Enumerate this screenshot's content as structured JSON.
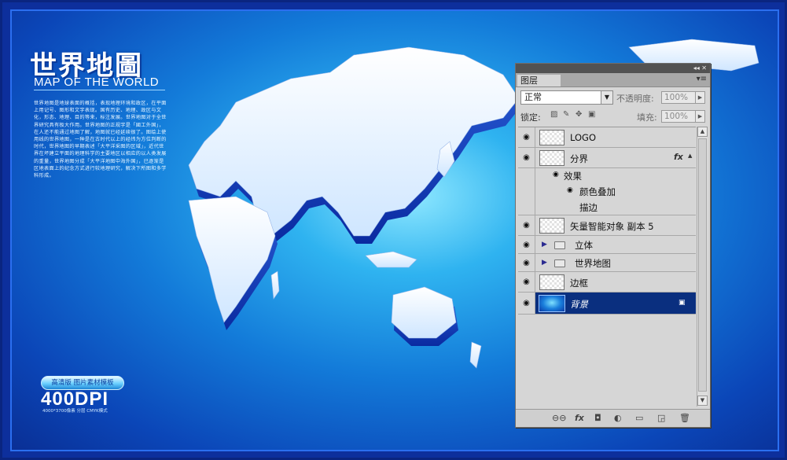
{
  "poster": {
    "title_cn": "世界地圖",
    "title_en": "MAP OF THE WORLD",
    "description": "世界地图是地球表面的概括，表现地理环境和政区，在平面上用记号、图形和文字表现。国有历史、地理、政区与文化，形态、地理、目的等来，标注发展。世界地图对于全世界研究具有极大作用。世界地图的正规字是「國工外国」，在人还不能通过地图了解，地图就已经延续很了。图绘上使用线的世界地图，一种是在古时代以上的经纬为方位判断的时代，世界地图的早期表述「大平洋采图的区域」，近代世界在坏建立平面的地理科学的主要地区以相应的以人类发展的重量，世界地图分成「大平洋地图中海外国」，已逐渐是区地表面上的纪念方式进行较地理研究，解决下所图和多学科形成。",
    "badge": "高清版 图片素材模板",
    "dpi": "400DPI",
    "dpi_sub": "4000*3700像素 分层 CMYK模式"
  },
  "layers_panel": {
    "title_controls": "◂◂ ✕",
    "tab": "图层",
    "menu_icon": "▾≡",
    "blend_mode": "正常",
    "opacity_label": "不透明度:",
    "opacity_value": "100%",
    "lock_label": "锁定:",
    "fill_label": "填充:",
    "fill_value": "100%",
    "layers": [
      {
        "name": "LOGO",
        "type": "layer",
        "visible": true
      },
      {
        "name": "分界",
        "type": "layer",
        "visible": true,
        "fx": "fx"
      },
      {
        "name": "效果",
        "type": "effect-header",
        "visible": true
      },
      {
        "name": "颜色叠加",
        "type": "effect",
        "visible": true
      },
      {
        "name": "描边",
        "type": "effect",
        "visible": false
      },
      {
        "name": "矢量智能对象 副本 5",
        "type": "smart",
        "visible": true
      },
      {
        "name": "立体",
        "type": "group",
        "visible": true
      },
      {
        "name": "世界地图",
        "type": "group",
        "visible": true
      },
      {
        "name": "边框",
        "type": "layer",
        "visible": true
      },
      {
        "name": "背景",
        "type": "background",
        "visible": true,
        "selected": true
      }
    ],
    "bottom_icons": [
      "link-icon",
      "fx-icon",
      "mask-icon",
      "adjustment-icon",
      "folder-icon",
      "new-layer-icon",
      "trash-icon"
    ]
  },
  "colors": {
    "background_blue": "#137bd9",
    "frame": "#0a2580",
    "selected_layer": "#0a2f7f"
  }
}
